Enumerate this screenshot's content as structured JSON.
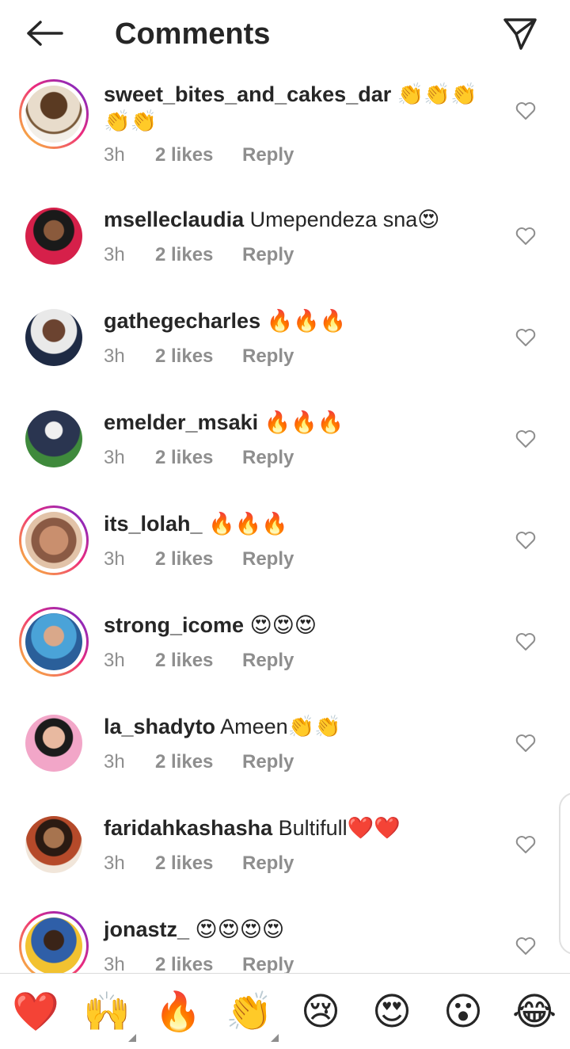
{
  "header": {
    "title": "Comments",
    "back_icon": "arrow-left-icon",
    "send_icon": "paper-plane-icon"
  },
  "comments": [
    {
      "username": "sweet_bites_and_cakes_dar",
      "text": "👏👏👏👏👏",
      "time": "3h",
      "likes": "2 likes",
      "reply": "Reply",
      "story_ring": true
    },
    {
      "username": "mselleclaudia",
      "text": "Umependeza sna😍",
      "time": "3h",
      "likes": "2 likes",
      "reply": "Reply",
      "story_ring": false
    },
    {
      "username": "gathegecharles",
      "text": "🔥🔥🔥",
      "time": "3h",
      "likes": "2 likes",
      "reply": "Reply",
      "story_ring": false
    },
    {
      "username": "emelder_msaki",
      "text": "🔥🔥🔥",
      "time": "3h",
      "likes": "2 likes",
      "reply": "Reply",
      "story_ring": false
    },
    {
      "username": "its_lolah_",
      "text": "🔥🔥🔥",
      "time": "3h",
      "likes": "2 likes",
      "reply": "Reply",
      "story_ring": true
    },
    {
      "username": "strong_icome",
      "text": "😍😍😍",
      "time": "3h",
      "likes": "2 likes",
      "reply": "Reply",
      "story_ring": true
    },
    {
      "username": "la_shadyto",
      "text": "Ameen👏👏",
      "time": "3h",
      "likes": "2 likes",
      "reply": "Reply",
      "story_ring": false
    },
    {
      "username": "faridahkashasha",
      "text": "Bultifull❤️❤️",
      "time": "3h",
      "likes": "2 likes",
      "reply": "Reply",
      "story_ring": false
    },
    {
      "username": "jonastz_",
      "text": "😍😍😍😍",
      "time": "3h",
      "likes": "2 likes",
      "reply": "Reply",
      "story_ring": true
    }
  ],
  "emoji_bar": [
    {
      "emoji": "❤️",
      "name": "red-heart"
    },
    {
      "emoji": "🙌",
      "name": "raising-hands"
    },
    {
      "emoji": "🔥",
      "name": "fire"
    },
    {
      "emoji": "👏",
      "name": "clapping-hands"
    },
    {
      "emoji": "😢",
      "name": "crying-face"
    },
    {
      "emoji": "😍",
      "name": "heart-eyes"
    },
    {
      "emoji": "😮",
      "name": "surprised-face"
    },
    {
      "emoji": "😂",
      "name": "tears-of-joy"
    }
  ],
  "colors": {
    "text": "#262626",
    "meta": "#8e8e8e",
    "story_ring_start": "#f9ce34",
    "story_ring_end": "#6228d7"
  }
}
